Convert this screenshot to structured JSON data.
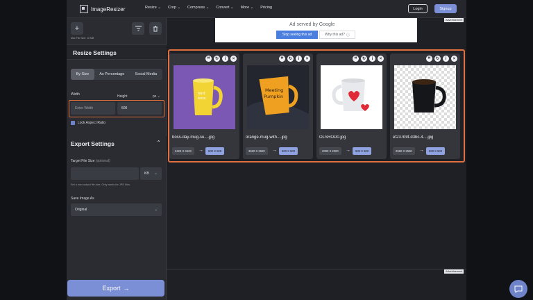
{
  "app": {
    "name": "ImageResizer"
  },
  "nav": {
    "links": [
      "Resize",
      "Crop",
      "Compress",
      "Convert",
      "More",
      "Pricing"
    ],
    "login": "Login",
    "signup": "Signup"
  },
  "sidebar": {
    "max_file_size": "Max File Size: 10 MB",
    "resize_title": "Resize Settings",
    "tabs": [
      "By Size",
      "As Percentage",
      "Social Media"
    ],
    "width_label": "Width",
    "height_label": "Height",
    "unit": "px",
    "width_placeholder": "Enter Width",
    "height_value": "500",
    "lock_label": "Lock Aspect Ratio",
    "export_title": "Export Settings",
    "target_label": "Target File Size",
    "target_optional": "(optional)",
    "target_unit": "KB",
    "target_hint": "Set a max output file size. Only works for JPG files.",
    "save_as_label": "Save Image As",
    "save_as_value": "Original",
    "export_button": "Export"
  },
  "ad": {
    "served_by": "Ad served by Google",
    "stop": "Stop seeing this ad",
    "why": "Why this ad?",
    "label": "Advertisement"
  },
  "images": [
    {
      "name": "boss-day-mug-su....jpg",
      "from": "3423 X 3423",
      "to": "500 X 500"
    },
    {
      "name": "orange-mug-with....jpg",
      "from": "3620 X 3620",
      "to": "500 X 500"
    },
    {
      "name": "OLSROD0.jpg",
      "from": "2000 X 2000",
      "to": "500 X 500"
    },
    {
      "name": "ef237b9f-d3bc-4....jpg",
      "from": "2560 X 2560",
      "to": "500 X 500"
    }
  ],
  "colors": {
    "accent": "#7b8fd6",
    "highlight": "#e0703e"
  }
}
